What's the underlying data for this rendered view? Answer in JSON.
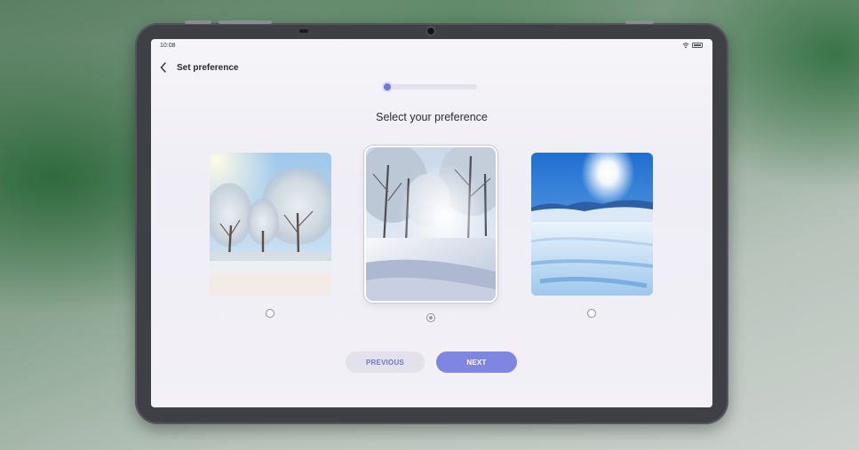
{
  "status_bar": {
    "time": "10:08",
    "wifi_icon": "wifi-icon",
    "battery_icon": "battery-icon"
  },
  "header": {
    "back_icon": "chevron-left-icon",
    "title": "Set preference"
  },
  "progress": {
    "current_step": 1,
    "fraction": 0.05
  },
  "main": {
    "heading": "Select your preference",
    "options": [
      {
        "id": "snowy-trees-sunlit",
        "selected": false
      },
      {
        "id": "snowy-forest-path",
        "selected": true
      },
      {
        "id": "snowy-field-blue-sky",
        "selected": false
      }
    ]
  },
  "buttons": {
    "previous_label": "PREVIOUS",
    "next_label": "NEXT"
  },
  "colors": {
    "accent": "#7e86e2",
    "secondary_button": "#e2e1ec",
    "secondary_text": "#7177c4"
  }
}
